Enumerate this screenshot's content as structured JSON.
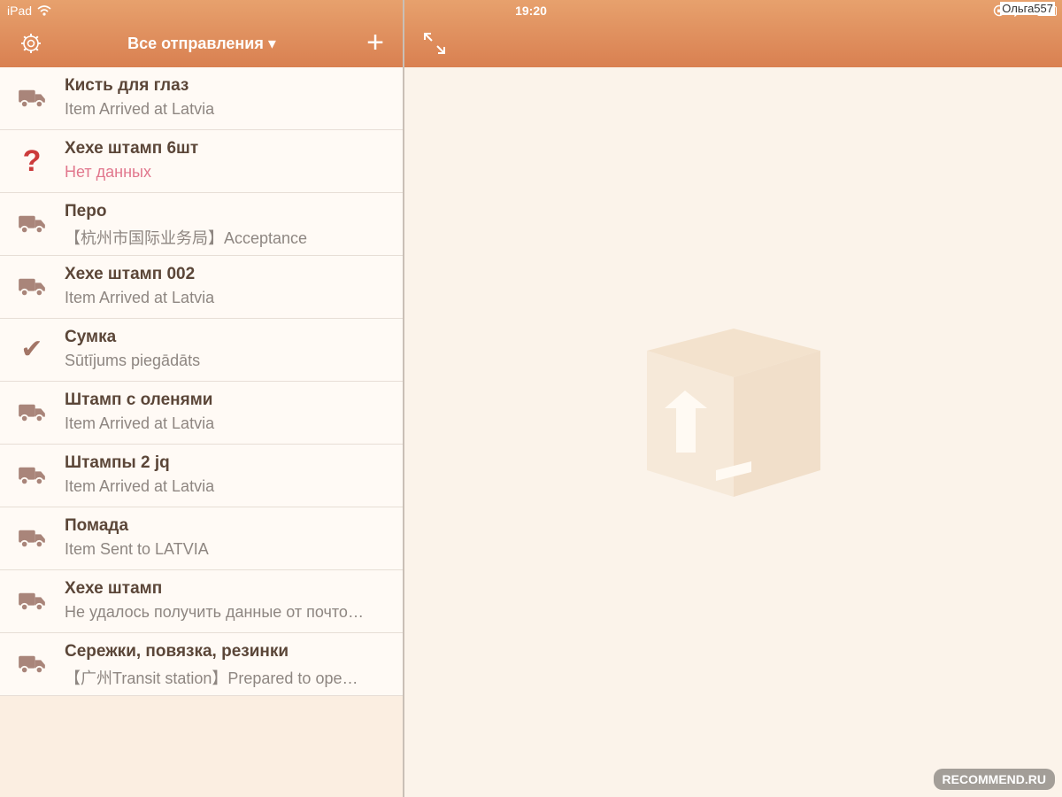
{
  "status_bar": {
    "device": "iPad",
    "time": "19:20",
    "battery_prefix": "9",
    "user_tag": "Ольга557"
  },
  "nav": {
    "title": "Все отправления ▾"
  },
  "shipments": [
    {
      "name": "Кисть для глаз",
      "status": "Item Arrived at Latvia",
      "icon": "truck-icon"
    },
    {
      "name": "Хехе штамп 6шт",
      "status": "Нет данных",
      "icon": "question-icon"
    },
    {
      "name": "Перо",
      "status": "【杭州市国际业务局】Acceptance",
      "icon": "truck-icon"
    },
    {
      "name": "Хехе штамп 002",
      "status": "Item Arrived at Latvia",
      "icon": "truck-icon"
    },
    {
      "name": "Сумка",
      "status": "Sūtījums piegādāts",
      "icon": "check-icon"
    },
    {
      "name": "Штамп с оленями",
      "status": "Item Arrived at Latvia",
      "icon": "truck-icon"
    },
    {
      "name": "Штампы 2 jq",
      "status": "Item Arrived at Latvia",
      "icon": "truck-icon"
    },
    {
      "name": "Помада",
      "status": "Item Sent to LATVIA",
      "icon": "truck-icon"
    },
    {
      "name": "Хехе штамп",
      "status": "Не удалось получить данные от почто…",
      "icon": "truck-icon"
    },
    {
      "name": "Сережки, повязка, резинки",
      "status": "【广州Transit station】Prepared to ope…",
      "icon": "truck-icon"
    }
  ],
  "watermark": "RECOMMEND.RU",
  "colors": {
    "header": "#d98051",
    "list_bg": "#fffaf5",
    "error_text": "#e1778d"
  }
}
